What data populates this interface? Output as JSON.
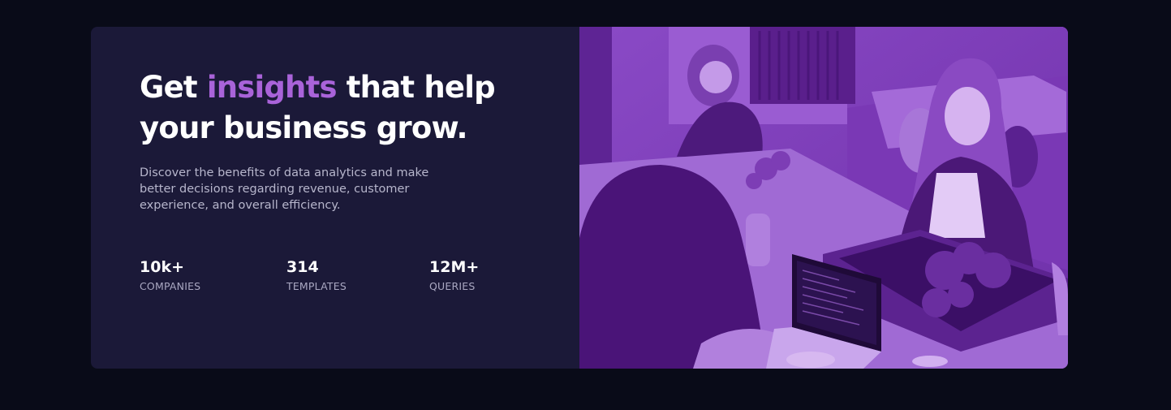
{
  "hero": {
    "headline_before": "Get ",
    "headline_accent": "insights",
    "headline_after": " that help your business grow.",
    "description": "Discover the benefits of data analytics and make better decisions regarding revenue, customer experience, and overall efficiency."
  },
  "stats": [
    {
      "value": "10k+",
      "label": "COMPANIES"
    },
    {
      "value": "314",
      "label": "TEMPLATES"
    },
    {
      "value": "12M+",
      "label": "QUERIES"
    }
  ],
  "colors": {
    "background": "#090b18",
    "card": "#1b1938",
    "accent": "#a963d9",
    "photo_tint": "#7b3cb8"
  },
  "image": {
    "icon": "office-team-photo"
  }
}
